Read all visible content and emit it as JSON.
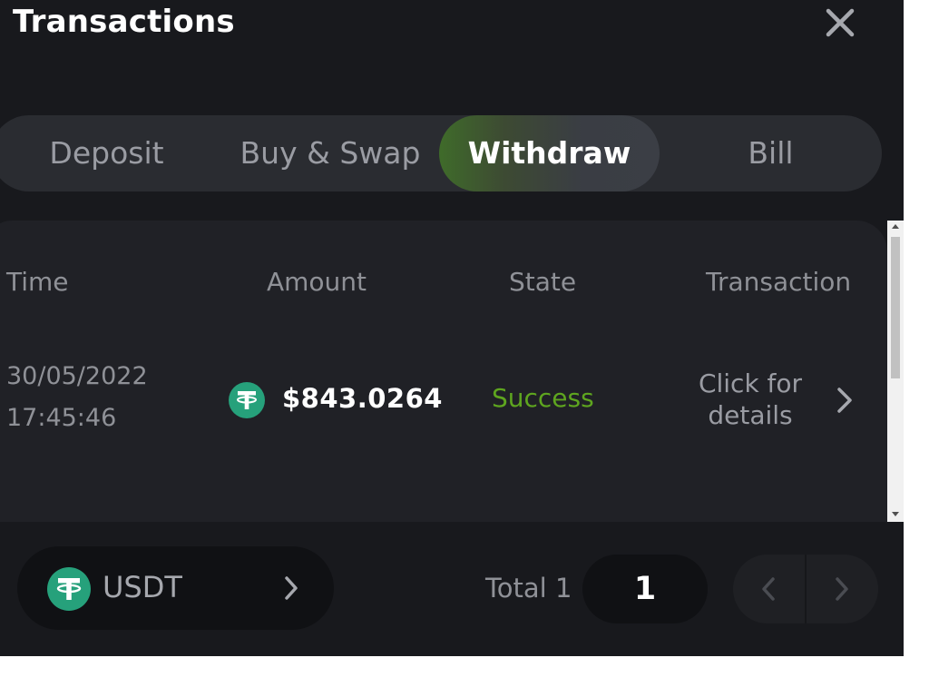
{
  "header": {
    "title": "Transactions",
    "close_icon": "close-icon"
  },
  "tabs": [
    {
      "label": "Deposit",
      "active": false
    },
    {
      "label": "Buy & Swap",
      "active": false
    },
    {
      "label": "Withdraw",
      "active": true
    },
    {
      "label": "Bill",
      "active": false
    }
  ],
  "table": {
    "columns": [
      "Time",
      "Amount",
      "State",
      "Transaction"
    ],
    "rows": [
      {
        "date": "30/05/2022",
        "time": "17:45:46",
        "coin_icon": "tether-icon",
        "amount": "$843.0264",
        "state": "Success",
        "transaction": "Click for details"
      }
    ]
  },
  "footer": {
    "coin": "USDT",
    "total_label": "Total 1",
    "current_page": "1"
  },
  "colors": {
    "background": "#18191d",
    "tab_bar": "#2a2c31",
    "active_tab_accent": "#3f6b2a",
    "success": "#5ea51f",
    "tether": "#26a17b"
  }
}
